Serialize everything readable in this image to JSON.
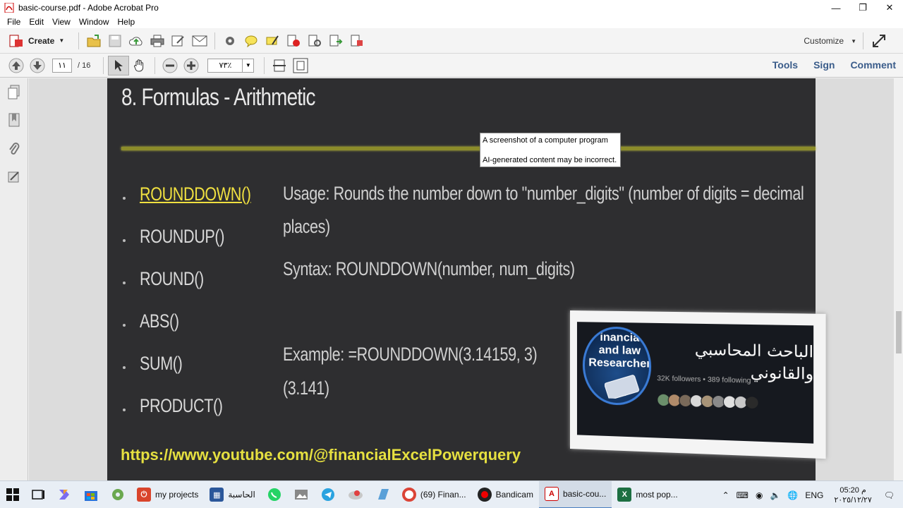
{
  "window": {
    "title": "basic-course.pdf - Adobe Acrobat Pro"
  },
  "menu": {
    "items": [
      "File",
      "Edit",
      "View",
      "Window",
      "Help"
    ]
  },
  "toolbar": {
    "create_label": "Create",
    "customize_label": "Customize"
  },
  "navbar": {
    "page_current": "١١",
    "page_total": "/ 16",
    "zoom": "٧٣٪",
    "links": {
      "tools": "Tools",
      "sign": "Sign",
      "comment": "Comment"
    }
  },
  "slide": {
    "title": "8. Formulas - Arithmetic",
    "functions": [
      "ROUNDDOWN()",
      "ROUNDUP()",
      "ROUND()",
      "ABS()",
      "SUM()",
      "PRODUCT()"
    ],
    "usage_line1": "Usage: Rounds the number down to \"number_digits\" (number of digits = decimal",
    "usage_line2": "places)",
    "syntax": "Syntax: ROUNDDOWN(number, num_digits)",
    "example": "Example: =ROUNDDOWN(3.14159, 3)",
    "example_result": "(3.141)",
    "link": "https://www.youtube.com/@financialExcelPowerquery"
  },
  "tooltip": {
    "line1": "A screenshot of a computer program",
    "line2": "AI-generated content may be incorrect."
  },
  "profile": {
    "avatar_line1": "inancia",
    "avatar_line2": "and law",
    "avatar_line3": "Researcher",
    "name_line1": "الباحث المحاسبي",
    "name_line2": "والقانوني",
    "stats": "32K followers • 389 following"
  },
  "taskbar": {
    "items": [
      "my projects",
      "الحاسبة",
      "(69) Finan...",
      "Bandicam",
      "basic-cou...",
      "most pop..."
    ],
    "lang": "ENG",
    "time": "05:20 م",
    "date": "٢٠٢٥/١٢/٢٧"
  },
  "colors": {
    "accent_blue": "#3a5c8a",
    "slide_bg": "#2e2e30",
    "highlight_yellow": "#f0e040"
  }
}
